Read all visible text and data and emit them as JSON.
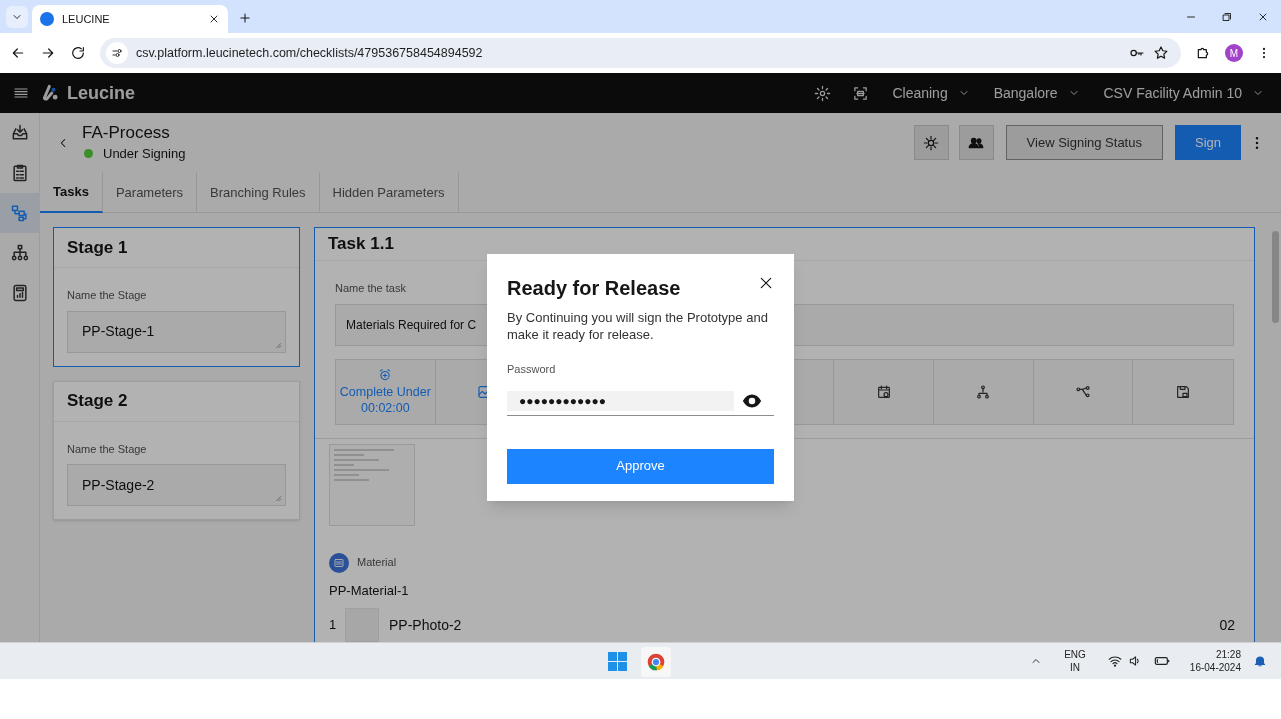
{
  "browser": {
    "tab_title": "LEUCINE",
    "url": "csv.platform.leucinetech.com/checklists/479536758454894592",
    "profile_initial": "M"
  },
  "header": {
    "brand": "Leucine",
    "menus": [
      {
        "label": "Cleaning"
      },
      {
        "label": "Bangalore"
      },
      {
        "label": "CSV Facility Admin 10"
      }
    ]
  },
  "sidebar": {
    "items": [
      {
        "selected": false
      },
      {
        "selected": false
      },
      {
        "selected": true
      },
      {
        "selected": false
      },
      {
        "selected": false
      }
    ]
  },
  "page": {
    "title": "FA-Process",
    "status": {
      "label": "Under Signing",
      "color": "#3a8f2a"
    },
    "buttons": [
      {
        "label": "View Signing Status",
        "kind": "outline"
      },
      {
        "label": "Sign",
        "kind": "primary"
      }
    ]
  },
  "tabs": [
    {
      "label": "Tasks",
      "selected": true
    },
    {
      "label": "Parameters",
      "selected": false
    },
    {
      "label": "Branching Rules",
      "selected": false
    },
    {
      "label": "Hidden Parameters",
      "selected": false
    }
  ],
  "stages": [
    {
      "title": "Stage 1",
      "field_label": "Name the Stage",
      "value": "PP-Stage-1",
      "selected": true
    },
    {
      "title": "Stage 2",
      "field_label": "Name the Stage",
      "value": "PP-Stage-2",
      "selected": false
    }
  ],
  "task": {
    "title": "Task 1.1",
    "field_label": "Name the task",
    "value": "Materials Required for C",
    "timer": {
      "label": "Complete Under",
      "value": "00:02:00"
    },
    "material": {
      "label": "Material",
      "name": "PP-Material-1",
      "rows": [
        {
          "index": "1",
          "name": "PP-Photo-2",
          "quantity": "02"
        }
      ]
    }
  },
  "dialog": {
    "title": "Ready for Release",
    "message": "By Continuing you will sign the Prototype and make it ready for release.",
    "password_label": "Password",
    "password_value": "●●●●●●●●●●●●",
    "button": "Approve"
  },
  "taskbar": {
    "language": "ENG",
    "region": "IN",
    "time": "21:28",
    "date": "16-04-2024"
  }
}
